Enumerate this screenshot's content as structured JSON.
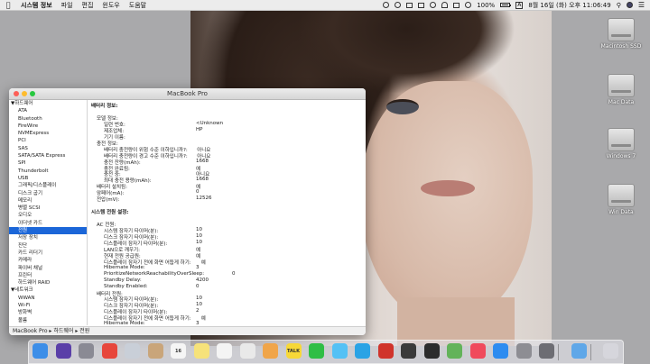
{
  "menubar": {
    "apple": "",
    "items": [
      "시스템 정보",
      "파일",
      "편집",
      "윈도우",
      "도움말"
    ],
    "battery_percent": "100%",
    "battery_level": 1.0,
    "input_source": "A",
    "clock": "8월 16일 (화) 오후 11:06:49"
  },
  "desktop": {
    "disks": [
      "Macintosh SSD",
      "Mac Data",
      "Windows 7",
      "Win Data"
    ]
  },
  "window": {
    "title": "MacBook Pro",
    "sidebar": [
      {
        "label": "▼하드웨어",
        "group": true
      },
      {
        "label": "ATA"
      },
      {
        "label": "Bluetooth"
      },
      {
        "label": "FireWire"
      },
      {
        "label": "NVMExpress"
      },
      {
        "label": "PCI"
      },
      {
        "label": "SAS"
      },
      {
        "label": "SATA/SATA Express"
      },
      {
        "label": "SPI"
      },
      {
        "label": "Thunderbolt"
      },
      {
        "label": "USB"
      },
      {
        "label": "그래픽/디스플레이"
      },
      {
        "label": "디스크 굽기"
      },
      {
        "label": "메모리"
      },
      {
        "label": "병렬 SCSI"
      },
      {
        "label": "오디오"
      },
      {
        "label": "이더넷 카드"
      },
      {
        "label": "전원",
        "selected": true
      },
      {
        "label": "저장 장치"
      },
      {
        "label": "진단"
      },
      {
        "label": "카드 리더기"
      },
      {
        "label": "카메라"
      },
      {
        "label": "파이버 채널"
      },
      {
        "label": "프린터"
      },
      {
        "label": "하드웨어 RAID"
      },
      {
        "label": "▼네트워크",
        "group": true
      },
      {
        "label": "WWAN"
      },
      {
        "label": "Wi-Fi"
      },
      {
        "label": "방화벽"
      },
      {
        "label": "볼륨"
      }
    ],
    "content": [
      {
        "text": "배터리 정보:",
        "head": true,
        "indent": 0
      },
      {
        "text": "",
        "indent": 0
      },
      {
        "text": "모델 정보:",
        "indent": 1
      },
      {
        "text": "일련 번호:",
        "value": "<Unknown",
        "indent": 2
      },
      {
        "text": "제조업체:",
        "value": "HP",
        "indent": 2
      },
      {
        "text": "기기 이름:",
        "value": "",
        "indent": 2
      },
      {
        "text": "충전 정보:",
        "indent": 1
      },
      {
        "text": "배터리 충전량이 위험 수준 이하입니까?:",
        "value": "아니요",
        "indent": 2
      },
      {
        "text": "배터리 충전량이 경고 수준 이하입니까?:",
        "value": "아니요",
        "indent": 2
      },
      {
        "text": "충전 잔량(mAh):",
        "value": "1668",
        "indent": 2
      },
      {
        "text": "충전 완료됨:",
        "value": "예",
        "indent": 2
      },
      {
        "text": "충전 중:",
        "value": "아니요",
        "indent": 2
      },
      {
        "text": "최대 충전 용량(mAh):",
        "value": "1668",
        "indent": 2
      },
      {
        "text": "배터리 설치됨:",
        "value": "예",
        "indent": 1
      },
      {
        "text": "암페어(mA):",
        "value": "0",
        "indent": 1
      },
      {
        "text": "전압(mV):",
        "value": "12526",
        "indent": 1
      },
      {
        "text": "",
        "indent": 0
      },
      {
        "text": "시스템 전원 설정:",
        "head": true,
        "indent": 0
      },
      {
        "text": "",
        "indent": 0
      },
      {
        "text": "AC 전원:",
        "indent": 1
      },
      {
        "text": "시스템 잠자기 타이머(분):",
        "value": "10",
        "indent": 2
      },
      {
        "text": "디스크 잠자기 타이머(분):",
        "value": "10",
        "indent": 2
      },
      {
        "text": "디스플레이 잠자기 타이머(분):",
        "value": "10",
        "indent": 2
      },
      {
        "text": "LAN으로 깨우기:",
        "value": "예",
        "indent": 2
      },
      {
        "text": "현재 전원 공급원:",
        "value": "예",
        "indent": 2
      },
      {
        "text": "디스플레이 잠자기 전에 화면 어둡게 하기:",
        "value": "예",
        "indent": 2
      },
      {
        "text": "Hibernate Mode:",
        "value": "3",
        "indent": 2
      },
      {
        "text": "PrioritizeNetworkReachabilityOverSleep:",
        "value": "0",
        "indent": 2
      },
      {
        "text": "Standby Delay:",
        "value": "4200",
        "indent": 2
      },
      {
        "text": "Standby Enabled:",
        "value": "0",
        "indent": 2
      },
      {
        "text": "배터리 전원:",
        "indent": 1
      },
      {
        "text": "시스템 잠자기 타이머(분):",
        "value": "10",
        "indent": 2
      },
      {
        "text": "디스크 잠자기 타이머(분):",
        "value": "10",
        "indent": 2
      },
      {
        "text": "디스플레이 잠자기 타이머(분):",
        "value": "2",
        "indent": 2
      },
      {
        "text": "디스플레이 잠자기 전에 화면 어둡게 하기:",
        "value": "예",
        "indent": 2
      },
      {
        "text": "Hibernate Mode:",
        "value": "3",
        "indent": 2
      }
    ],
    "statusbar": "MacBook Pro ▸ 하드웨어 ▸ 전원"
  },
  "dock": {
    "apps": [
      {
        "name": "finder-icon",
        "color": "#3d8ee8",
        "text": ""
      },
      {
        "name": "siri-icon",
        "color": "#5a3fa8",
        "text": ""
      },
      {
        "name": "launchpad-icon",
        "color": "#8a8a94",
        "text": ""
      },
      {
        "name": "chrome-icon",
        "color": "#e7463b",
        "text": ""
      },
      {
        "name": "mail-icon",
        "color": "#c9cfd8",
        "text": ""
      },
      {
        "name": "contacts-icon",
        "color": "#c9a57a",
        "text": ""
      },
      {
        "name": "calendar-icon",
        "color": "#f5f5f5",
        "text": "16"
      },
      {
        "name": "notes-icon",
        "color": "#f6e27a",
        "text": ""
      },
      {
        "name": "reminders-icon",
        "color": "#f4f4f4",
        "text": ""
      },
      {
        "name": "stickies-icon",
        "color": "#e9e9e9",
        "text": ""
      },
      {
        "name": "photos-icon",
        "color": "#f0a54a",
        "text": ""
      },
      {
        "name": "kakaotalk-icon",
        "color": "#f7d838",
        "text": "TALK"
      },
      {
        "name": "line-icon",
        "color": "#2fbe45",
        "text": ""
      },
      {
        "name": "messages-icon",
        "color": "#53c1f5",
        "text": ""
      },
      {
        "name": "skype-icon",
        "color": "#2aa3e5",
        "text": ""
      },
      {
        "name": "app-red-icon",
        "color": "#d0342c",
        "text": ""
      },
      {
        "name": "app-dark-icon",
        "color": "#3a3a3a",
        "text": ""
      },
      {
        "name": "terminal-icon",
        "color": "#2c2c2c",
        "text": ""
      },
      {
        "name": "maps-icon",
        "color": "#63b35a",
        "text": ""
      },
      {
        "name": "itunes-icon",
        "color": "#f04a5c",
        "text": ""
      },
      {
        "name": "app-store-icon",
        "color": "#2e8cf0",
        "text": ""
      },
      {
        "name": "system-preferences-icon",
        "color": "#8d8d93",
        "text": ""
      },
      {
        "name": "system-info-icon",
        "color": "#6d6d73",
        "text": ""
      },
      {
        "name": "folder-icon",
        "color": "#5fa7e8",
        "text": ""
      },
      {
        "name": "trash-icon",
        "color": "#d6d6dc",
        "text": ""
      }
    ]
  }
}
